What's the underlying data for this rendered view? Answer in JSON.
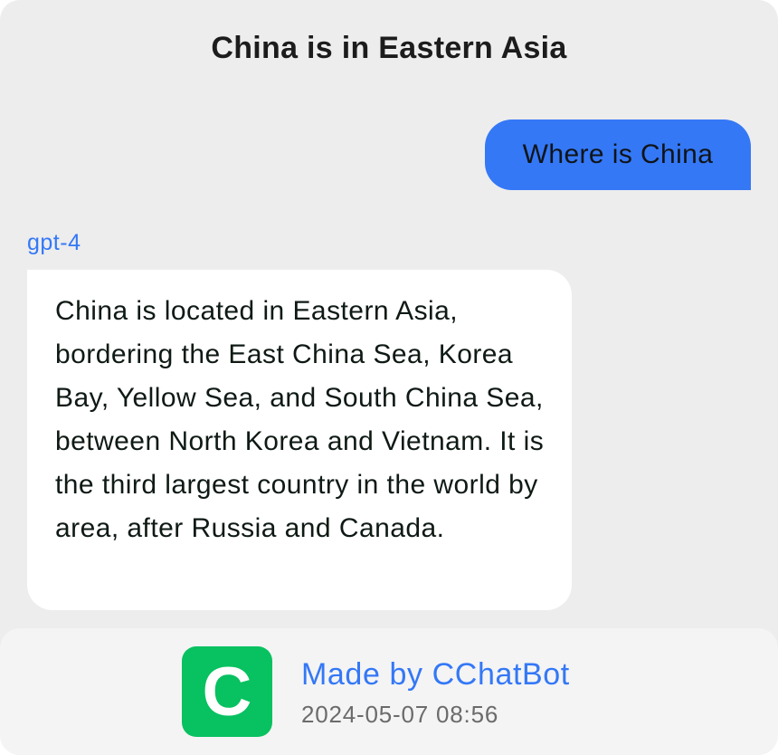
{
  "header": {
    "title": "China is in Eastern Asia"
  },
  "conversation": {
    "user_message": "Where is China",
    "model_name": "gpt-4",
    "bot_message": "China is located in Eastern Asia, bordering the East China Sea, Korea Bay, Yellow Sea, and South China Sea, between North Korea and Vietnam. It is the third largest country in the world by area, after Russia and Canada."
  },
  "footer": {
    "logo_letter": "C",
    "brand": "Made by CChatBot",
    "timestamp": "2024-05-07 08:56"
  },
  "colors": {
    "accent": "#3478f6",
    "logo_green": "#08c160",
    "background": "#ededed",
    "footer_background": "#f4f4f4"
  },
  "icons": {
    "logo": "cchatbot-logo-icon"
  }
}
